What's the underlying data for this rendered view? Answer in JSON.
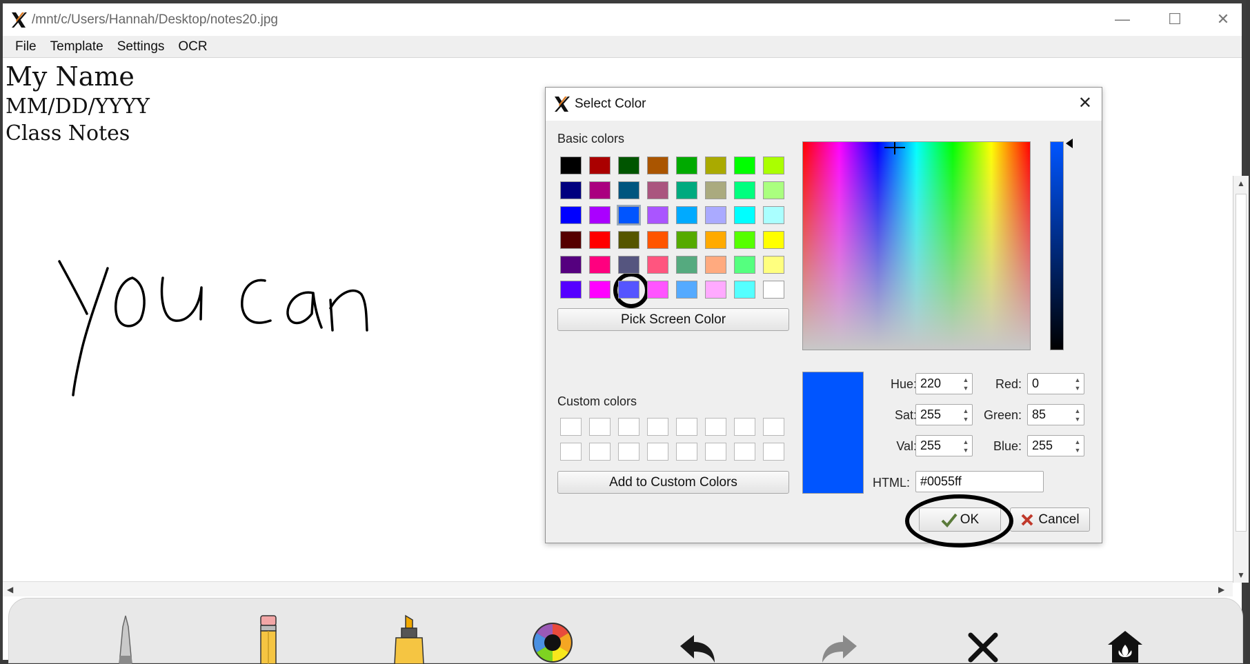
{
  "window": {
    "title": "/mnt/c/Users/Hannah/Desktop/notes20.jpg",
    "minimize_glyph": "—",
    "maximize_glyph": "☐",
    "close_glyph": "✕"
  },
  "menu": [
    "File",
    "Template",
    "Settings",
    "OCR"
  ],
  "canvas": {
    "lines": [
      "My Name",
      "MM/DD/YYYY",
      "Class Notes"
    ],
    "handwriting": "you can"
  },
  "dialog": {
    "title": "Select Color",
    "close_glyph": "✕",
    "basic_colors_label": "Basic colors",
    "basic_colors": [
      [
        "#000000",
        "#aa0000",
        "#005500",
        "#aa5500",
        "#00aa00",
        "#aaaa00",
        "#00ff00",
        "#aaff00"
      ],
      [
        "#00007f",
        "#aa007f",
        "#00557f",
        "#aa557f",
        "#00aa7f",
        "#aaaa7f",
        "#00ff7f",
        "#aaff7f"
      ],
      [
        "#0000ff",
        "#aa00ff",
        "#0055ff",
        "#aa55ff",
        "#00aaff",
        "#aaaaff",
        "#00ffff",
        "#aaffff"
      ],
      [
        "#550000",
        "#ff0000",
        "#555500",
        "#ff5500",
        "#55aa00",
        "#ffaa00",
        "#55ff00",
        "#ffff00"
      ],
      [
        "#55007f",
        "#ff007f",
        "#55557f",
        "#ff557f",
        "#55aa7f",
        "#ffaa7f",
        "#55ff7f",
        "#ffff7f"
      ],
      [
        "#5500ff",
        "#ff00ff",
        "#5555ff",
        "#ff55ff",
        "#55aaff",
        "#ffaaff",
        "#55ffff",
        "#ffffff"
      ]
    ],
    "pick_screen_color": "Pick Screen Color",
    "custom_colors_label": "Custom colors",
    "add_custom": "Add to Custom Colors",
    "preview_color": "#0055ff",
    "fields": {
      "hue": {
        "label": "Hue:",
        "value": "220"
      },
      "sat": {
        "label": "Sat:",
        "value": "255"
      },
      "val": {
        "label": "Val:",
        "value": "255"
      },
      "red": {
        "label": "Red:",
        "value": "0"
      },
      "green": {
        "label": "Green:",
        "value": "85"
      },
      "blue": {
        "label": "Blue:",
        "value": "255"
      }
    },
    "html_label": "HTML:",
    "html_value": "#0055ff",
    "ok_label": "OK",
    "cancel_label": "Cancel"
  },
  "toolbar": {
    "tools": [
      "pen-icon",
      "pencil-icon",
      "highlighter-icon",
      "color-wheel-icon",
      "undo-icon",
      "redo-icon",
      "close-icon",
      "home-icon"
    ]
  }
}
